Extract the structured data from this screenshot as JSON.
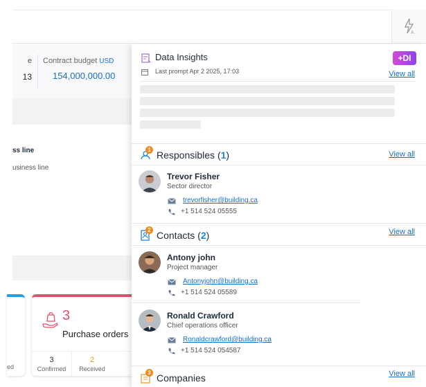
{
  "background": {
    "stat_a_label": "e",
    "stat_a_value": "13",
    "contract_budget": {
      "label": "Contract budget",
      "currency": "USD",
      "value": "154,000,000.00"
    },
    "business_line": {
      "title": "ss line",
      "subtitle": "usiness line"
    },
    "left_card_suffix": "ed",
    "purchase_orders": {
      "count": "3",
      "label": "Purchase orders",
      "confirmed": {
        "count": "3",
        "label": "Confirmed"
      },
      "received": {
        "count": "2",
        "label": "Received"
      }
    }
  },
  "panel": {
    "data_insights": {
      "title": "Data Insights",
      "badge": "+DI",
      "last_prompt": "Last prompt Apr 2 2025, 17:03",
      "view_all": "View all"
    },
    "responsibles": {
      "title": "Responsibles",
      "count": "1",
      "badge": "1",
      "view_all": "View all",
      "people": [
        {
          "name": "Trevor Fisher",
          "role": "Sector director",
          "email": "trevorfisher@building.ca",
          "phone": "+1 514 524 05555"
        }
      ]
    },
    "contacts": {
      "title": "Contacts",
      "count": "2",
      "badge": "2",
      "view_all": "View all",
      "people": [
        {
          "name": "Antony john",
          "role": "Project manager",
          "email": "Antonyjohn@building.ca",
          "phone": "+1 514 524 05589"
        },
        {
          "name": "Ronald Crawford",
          "role": "Chief operations officer",
          "email": "Ronaldcrawford@building.ca",
          "phone": "+1 514 524 054587"
        }
      ]
    },
    "companies": {
      "title": "Companies",
      "badge": "3",
      "view_all": "View all"
    }
  },
  "colors": {
    "accent_blue": "#1a84d8",
    "link": "#1570c8",
    "badge_orange": "#f08a1c",
    "po_red": "#e0526d",
    "di_gradient_start": "#d64ad1",
    "di_gradient_end": "#8e43f0"
  }
}
